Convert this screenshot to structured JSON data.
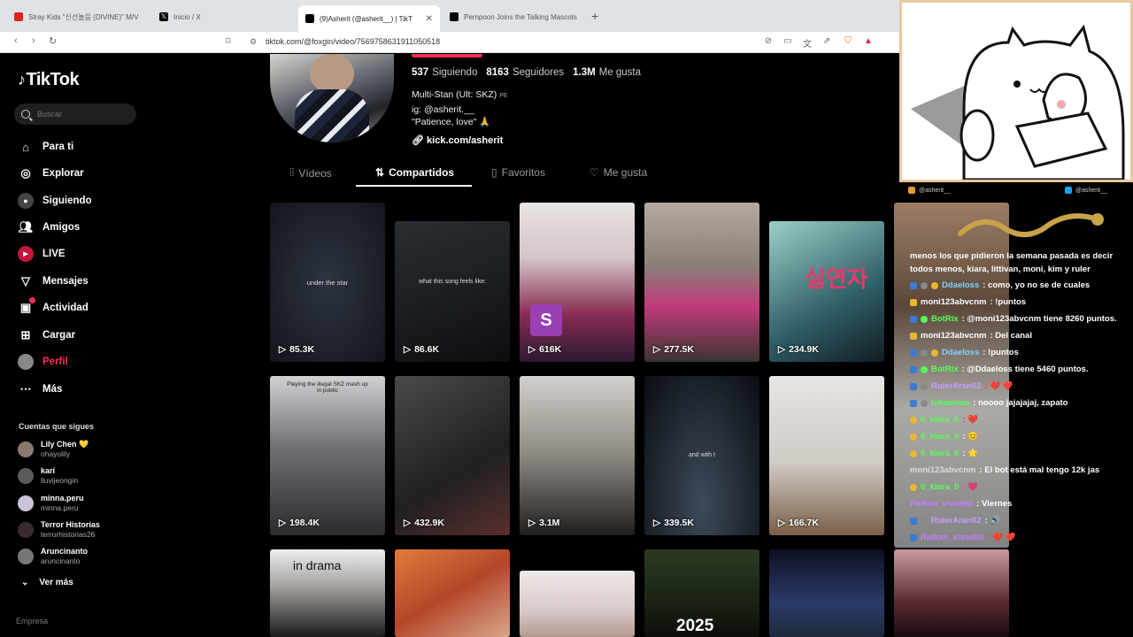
{
  "browser": {
    "tabs": [
      {
        "title": "Stray Kids \"신선놀음 (DIVINE)\" M/V",
        "favicon_color": "#e62117"
      },
      {
        "title": "Inicio / X",
        "favicon_color": "#000000"
      },
      {
        "title": "(9)Asherit (@asherit__) | TikT",
        "favicon_color": "#000000"
      },
      {
        "title": "Pernpoon Joins the Talking Mascots",
        "favicon_color": "#000000"
      }
    ],
    "url": "tiktok.com/@foxgin/video/7569758631911050518"
  },
  "sidebar": {
    "logo": "TikTok",
    "search_placeholder": "Buscar",
    "nav": [
      {
        "label": "Para ti",
        "icon": "home-icon"
      },
      {
        "label": "Explorar",
        "icon": "compass-icon"
      },
      {
        "label": "Siguiendo",
        "icon": "following-icon"
      },
      {
        "label": "Amigos",
        "icon": "friends-icon"
      },
      {
        "label": "LIVE",
        "icon": "live-icon"
      },
      {
        "label": "Mensajes",
        "icon": "inbox-icon"
      },
      {
        "label": "Actividad",
        "icon": "activity-icon"
      },
      {
        "label": "Cargar",
        "icon": "upload-icon"
      },
      {
        "label": "Perfil",
        "icon": "profile-icon"
      },
      {
        "label": "Más",
        "icon": "more-icon"
      }
    ],
    "following_title": "Cuentas que sigues",
    "following": [
      {
        "name": "Lily Chen 💛",
        "handle": "ohayolily"
      },
      {
        "name": "kari",
        "handle": "lluvijeongin"
      },
      {
        "name": "minna.peru",
        "handle": "minna.peru"
      },
      {
        "name": "Terror Historias",
        "handle": "terrorhistorias26"
      },
      {
        "name": "Aruncinanto",
        "handle": "aruncinanto"
      }
    ],
    "see_more": "Ver más",
    "footer": "Empresa"
  },
  "profile": {
    "stats": [
      {
        "value": "537",
        "label": "Siguiendo"
      },
      {
        "value": "8163",
        "label": "Seguidores"
      },
      {
        "value": "1.3M",
        "label": "Me gusta"
      }
    ],
    "bio_line1": "Multi-Stan (Ult: SKZ)",
    "bio_flag": "PE",
    "bio_line2": "ig: @asherit.__",
    "bio_line3": "\"Patience, love\" 🙏",
    "link": "kick.com/asherit",
    "tabs": [
      "Vídeos",
      "Compartidos",
      "Favoritos",
      "Me gusta"
    ]
  },
  "videos": [
    {
      "views": "85.3K",
      "caption": "under the star"
    },
    {
      "views": "86.6K",
      "caption": "what this song feels like:"
    },
    {
      "views": "616K",
      "caption": "S"
    },
    {
      "views": "277.5K",
      "caption": ""
    },
    {
      "views": "234.9K",
      "caption": "실연자"
    },
    {
      "views": "198.4K",
      "caption": "Playing the illegal SKZ mash up in public"
    },
    {
      "views": "432.9K",
      "caption": ""
    },
    {
      "views": "3.1M",
      "caption": ""
    },
    {
      "views": "339.5K",
      "caption": "and with t"
    },
    {
      "views": "166.7K",
      "caption": ""
    },
    {
      "views": "",
      "caption": "in drama"
    },
    {
      "views": "",
      "caption": ""
    },
    {
      "views": "",
      "caption": ""
    },
    {
      "views": "",
      "caption": "2025"
    },
    {
      "views": "",
      "caption": ""
    }
  ],
  "overlay": {
    "social_left": "@asherit__",
    "social_right": "@asherit__",
    "chat_header": "menos los que pidieron la semana pasada es decir todos menos, kiara, littivan, moni, kim y ruler",
    "chat": [
      {
        "user": "Ddaeloss",
        "msg": ": como, yo no se de cuales",
        "color": "#7fd4ff"
      },
      {
        "user": "moni123abvcnm",
        "msg": ": !puntos",
        "color": "#ffffff"
      },
      {
        "user": "BotRix",
        "msg": ": @moni123abvcnm tiene 8260 puntos.",
        "color": "#55ff55"
      },
      {
        "user": "moni123abvcnm",
        "msg": ": Del canal",
        "color": "#ffffff"
      },
      {
        "user": "Ddaeloss",
        "msg": ": !puntos",
        "color": "#7fd4ff"
      },
      {
        "user": "BotRix",
        "msg": ": @Ddaeloss tiene 5460 puntos.",
        "color": "#55ff55"
      },
      {
        "user": "RulerAran02",
        "msg": ": ❤️ ❤️",
        "color": "#c0a0ff"
      },
      {
        "user": "Ichadows",
        "msg": ": noooo jajajajaj, zapato",
        "color": "#55ff55"
      },
      {
        "user": "0_kiara_0",
        "msg": ": ❤️",
        "color": "#55ff55"
      },
      {
        "user": "0_kiara_0",
        "msg": ": 😊",
        "color": "#55ff55"
      },
      {
        "user": "0_kiara_0",
        "msg": ": 🌟",
        "color": "#55ff55"
      },
      {
        "user": "moni123abvcnm",
        "msg": ": El bot está mal tengo 12k jas",
        "color": "#ffffff"
      },
      {
        "user": "0_kiara_0",
        "msg": ": 💗",
        "color": "#55ff55"
      },
      {
        "user": "Ralkan_vivaelbl",
        "msg": ": Viernes",
        "color": "#c080ff"
      },
      {
        "user": "RulerAran02",
        "msg": ": 🔊",
        "color": "#c0a0ff"
      },
      {
        "user": "Ralkan_vivaelbl",
        "msg": ": ❤️ ❤️",
        "color": "#c080ff"
      }
    ]
  },
  "colors": {
    "accent": "#fe2c55",
    "background": "#000000"
  }
}
